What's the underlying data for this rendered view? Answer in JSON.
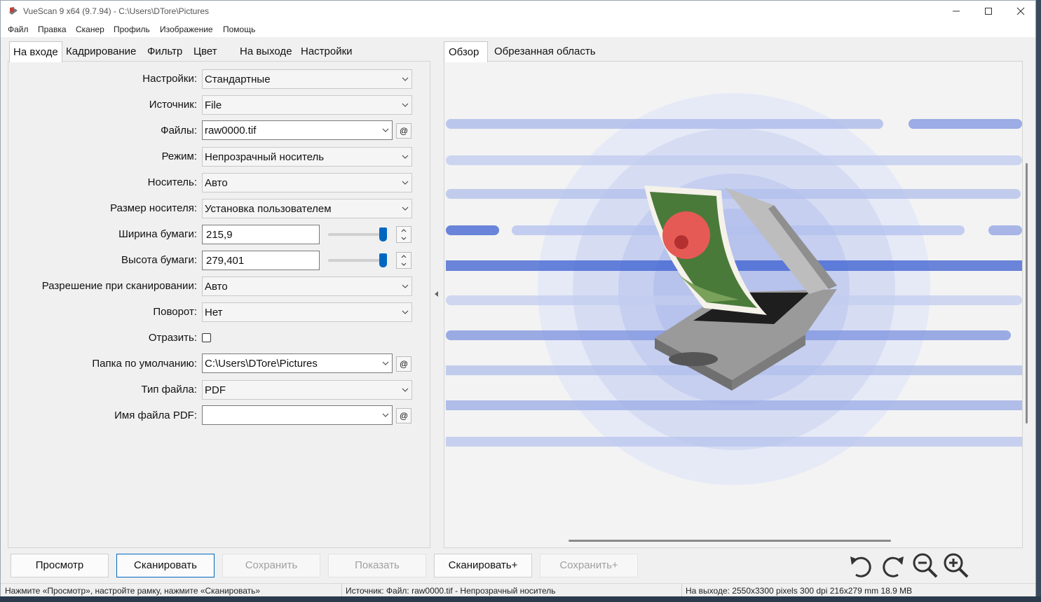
{
  "window": {
    "title": "VueScan 9 x64 (9.7.94) - C:\\Users\\DTore\\Pictures"
  },
  "menu": [
    "Файл",
    "Правка",
    "Сканер",
    "Профиль",
    "Изображение",
    "Помощь"
  ],
  "left_tabs": [
    "На входе",
    "Кадрирование",
    "Фильтр",
    "Цвет",
    "На выходе",
    "Настройки"
  ],
  "right_tabs": [
    "Обзор",
    "Обрезанная область"
  ],
  "form": {
    "settings": {
      "label": "Настройки:",
      "value": "Стандартные"
    },
    "source": {
      "label": "Источник:",
      "value": "File"
    },
    "files": {
      "label": "Файлы:",
      "value": "raw0000.tif"
    },
    "mode": {
      "label": "Режим:",
      "value": "Непрозрачный носитель"
    },
    "media": {
      "label": "Носитель:",
      "value": "Авто"
    },
    "media_size": {
      "label": "Размер носителя:",
      "value": "Установка пользователем"
    },
    "paper_width": {
      "label": "Ширина бумаги:",
      "value": "215,9"
    },
    "paper_height": {
      "label": "Высота бумаги:",
      "value": "279,401"
    },
    "resolution": {
      "label": "Разрешение при сканировании:",
      "value": "Авто"
    },
    "rotation": {
      "label": "Поворот:",
      "value": "Нет"
    },
    "mirror": {
      "label": "Отразить:",
      "checked": false
    },
    "default_folder": {
      "label": "Папка по умолчанию:",
      "value": "C:\\Users\\DTore\\Pictures"
    },
    "file_type": {
      "label": "Тип файла:",
      "value": "PDF"
    },
    "pdf_filename": {
      "label": "Имя файла PDF:",
      "value": ""
    },
    "at_symbol": "@"
  },
  "buttons": {
    "preview": "Просмотр",
    "scan": "Сканировать",
    "save": "Сохранить",
    "show": "Показать",
    "scan_plus": "Сканировать+",
    "save_plus": "Сохранить+"
  },
  "status": {
    "hint": "Нажмите «Просмотр», настройте рамку, нажмите «Сканировать»",
    "source": "Источник: Файл: raw0000.tif - Непрозрачный носитель",
    "output": "На выходе: 2550x3300 pixels 300 dpi 216x279 mm 18.9 MB"
  },
  "icons": [
    "app-icon",
    "minimize-icon",
    "maximize-icon",
    "close-icon",
    "dropdown-arrow-icon",
    "spin-up-icon",
    "spin-down-icon",
    "collapse-arrow-icon",
    "scanner-illustration",
    "rotate-left-icon",
    "rotate-right-icon",
    "zoom-out-icon",
    "zoom-in-icon"
  ],
  "colors": {
    "accent": "#0067c0",
    "preview_bars": "#3b5fd0",
    "preview_circles": "#c9d2f0"
  }
}
